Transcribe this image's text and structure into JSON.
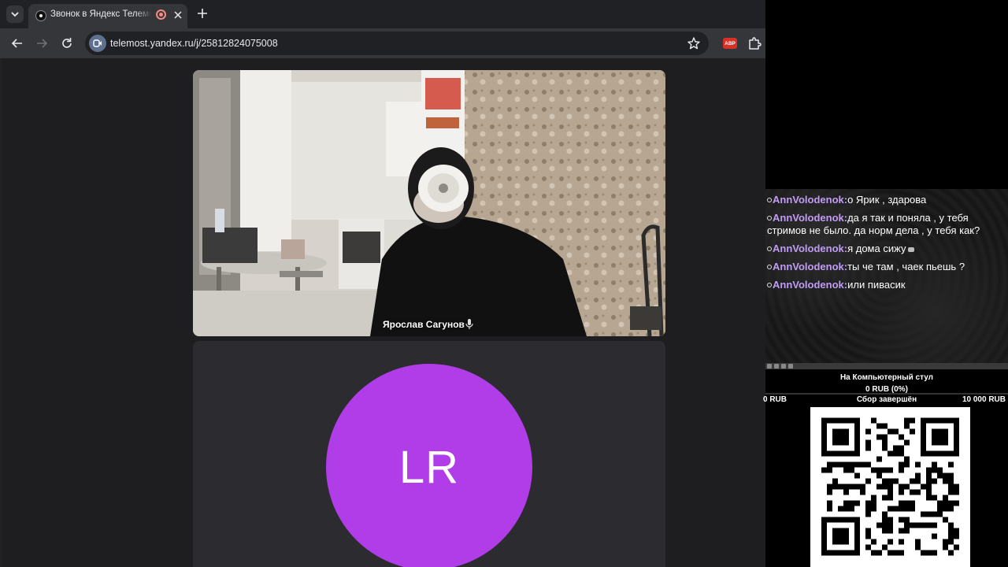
{
  "browser": {
    "tab": {
      "title": "Звонок в Яндекс Телемост"
    },
    "address_bar": {
      "url": "telemost.yandex.ru/j/25812824075008"
    },
    "extensions": {
      "abp_label": "ABP"
    }
  },
  "call": {
    "participant_video": {
      "name": "Ярослав Сагунов"
    },
    "participant_avatar": {
      "initials": "LR",
      "color": "#b03de8"
    }
  },
  "chat": {
    "messages": [
      {
        "user": "AnnVolodenok:",
        "text": "о Ярик , здарова"
      },
      {
        "user": "AnnVolodenok:",
        "text": "да я так и поняла , у тебя стримов не было. да норм дела , у тебя как?"
      },
      {
        "user": "AnnVolodenok:",
        "text": "я дома сижу"
      },
      {
        "user": "AnnVolodenok:",
        "text": "ты че там , чаек пьешь ?"
      },
      {
        "user": "AnnVolodenok:",
        "text": "или пивасик"
      }
    ],
    "user_color": "#c19cf5"
  },
  "donation_goal": {
    "title": "На Компьютерный стул",
    "amount": "0 RUB (0%)",
    "min": "0 RUB",
    "status": "Сбор завершён",
    "max": "10 000 RUB",
    "progress": 0
  }
}
